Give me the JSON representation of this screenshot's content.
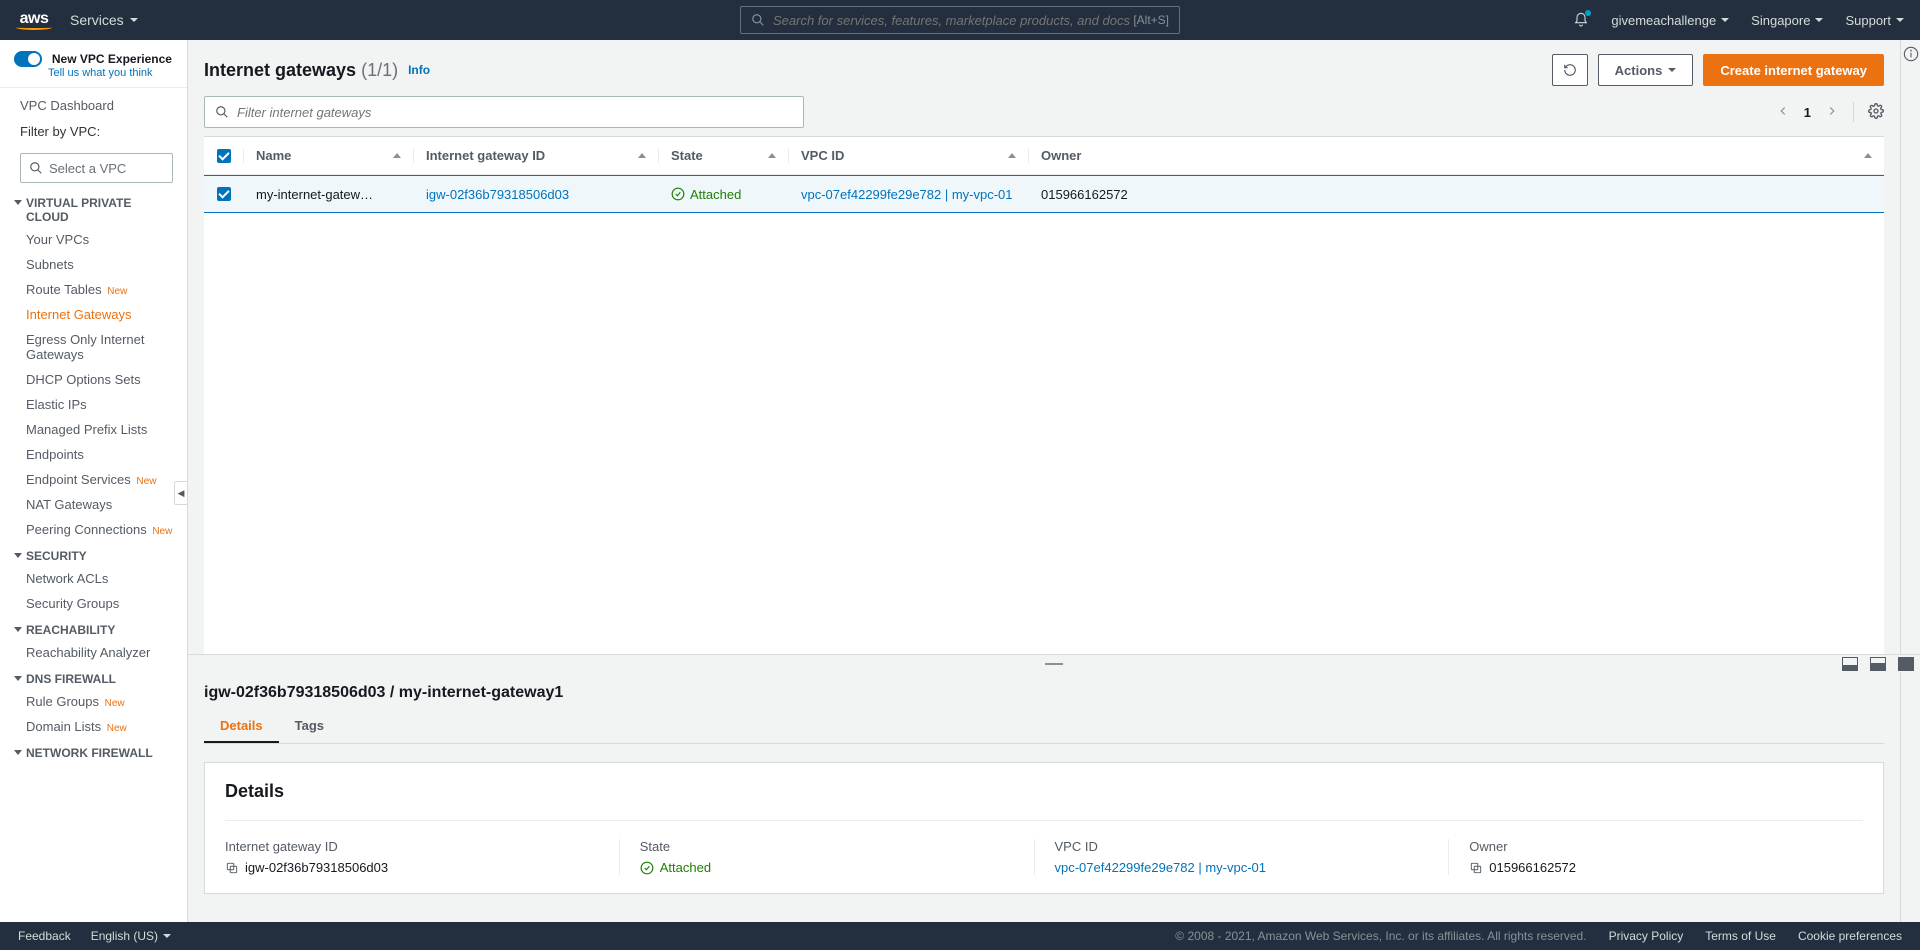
{
  "topnav": {
    "logo": "aws",
    "services": "Services",
    "search_placeholder": "Search for services, features, marketplace products, and docs",
    "search_kbd": "[Alt+S]",
    "user": "givemeachallenge",
    "region": "Singapore",
    "support": "Support"
  },
  "sidebar": {
    "new_experience": "New VPC Experience",
    "new_experience_sub": "Tell us what you think",
    "dashboard": "VPC Dashboard",
    "filter_label": "Filter by VPC:",
    "filter_placeholder": "Select a VPC",
    "sections": {
      "vpc": "VIRTUAL PRIVATE CLOUD",
      "security": "SECURITY",
      "reachability": "REACHABILITY",
      "dns": "DNS FIREWALL",
      "netfw": "NETWORK FIREWALL"
    },
    "items": {
      "your_vpcs": "Your VPCs",
      "subnets": "Subnets",
      "route_tables": "Route Tables",
      "igw": "Internet Gateways",
      "egress": "Egress Only Internet Gateways",
      "dhcp": "DHCP Options Sets",
      "eip": "Elastic IPs",
      "prefix": "Managed Prefix Lists",
      "endpoints": "Endpoints",
      "endpoint_svc": "Endpoint Services",
      "nat": "NAT Gateways",
      "peering": "Peering Connections",
      "nacl": "Network ACLs",
      "sg": "Security Groups",
      "reach": "Reachability Analyzer",
      "rule_groups": "Rule Groups",
      "domain_lists": "Domain Lists"
    },
    "new_badge": "New"
  },
  "header": {
    "title": "Internet gateways",
    "count": "(1/1)",
    "info": "Info",
    "refresh": "Refresh",
    "actions": "Actions",
    "create": "Create internet gateway",
    "filter_placeholder": "Filter internet gateways",
    "page": "1"
  },
  "table": {
    "columns": {
      "name": "Name",
      "igw": "Internet gateway ID",
      "state": "State",
      "vpc": "VPC ID",
      "owner": "Owner"
    },
    "rows": [
      {
        "name": "my-internet-gatew…",
        "igw": "igw-02f36b79318506d03",
        "state": "Attached",
        "vpc": "vpc-07ef42299fe29e782 | my-vpc-01",
        "owner": "015966162572"
      }
    ]
  },
  "detail": {
    "title": "igw-02f36b79318506d03 / my-internet-gateway1",
    "tabs": {
      "details": "Details",
      "tags": "Tags"
    },
    "panel_title": "Details",
    "fields": {
      "igw_label": "Internet gateway ID",
      "igw_value": "igw-02f36b79318506d03",
      "state_label": "State",
      "state_value": "Attached",
      "vpc_label": "VPC ID",
      "vpc_value": "vpc-07ef42299fe29e782 | my-vpc-01",
      "owner_label": "Owner",
      "owner_value": "015966162572"
    }
  },
  "footer": {
    "feedback": "Feedback",
    "language": "English (US)",
    "copyright": "© 2008 - 2021, Amazon Web Services, Inc. or its affiliates. All rights reserved.",
    "privacy": "Privacy Policy",
    "terms": "Terms of Use",
    "cookies": "Cookie preferences"
  }
}
